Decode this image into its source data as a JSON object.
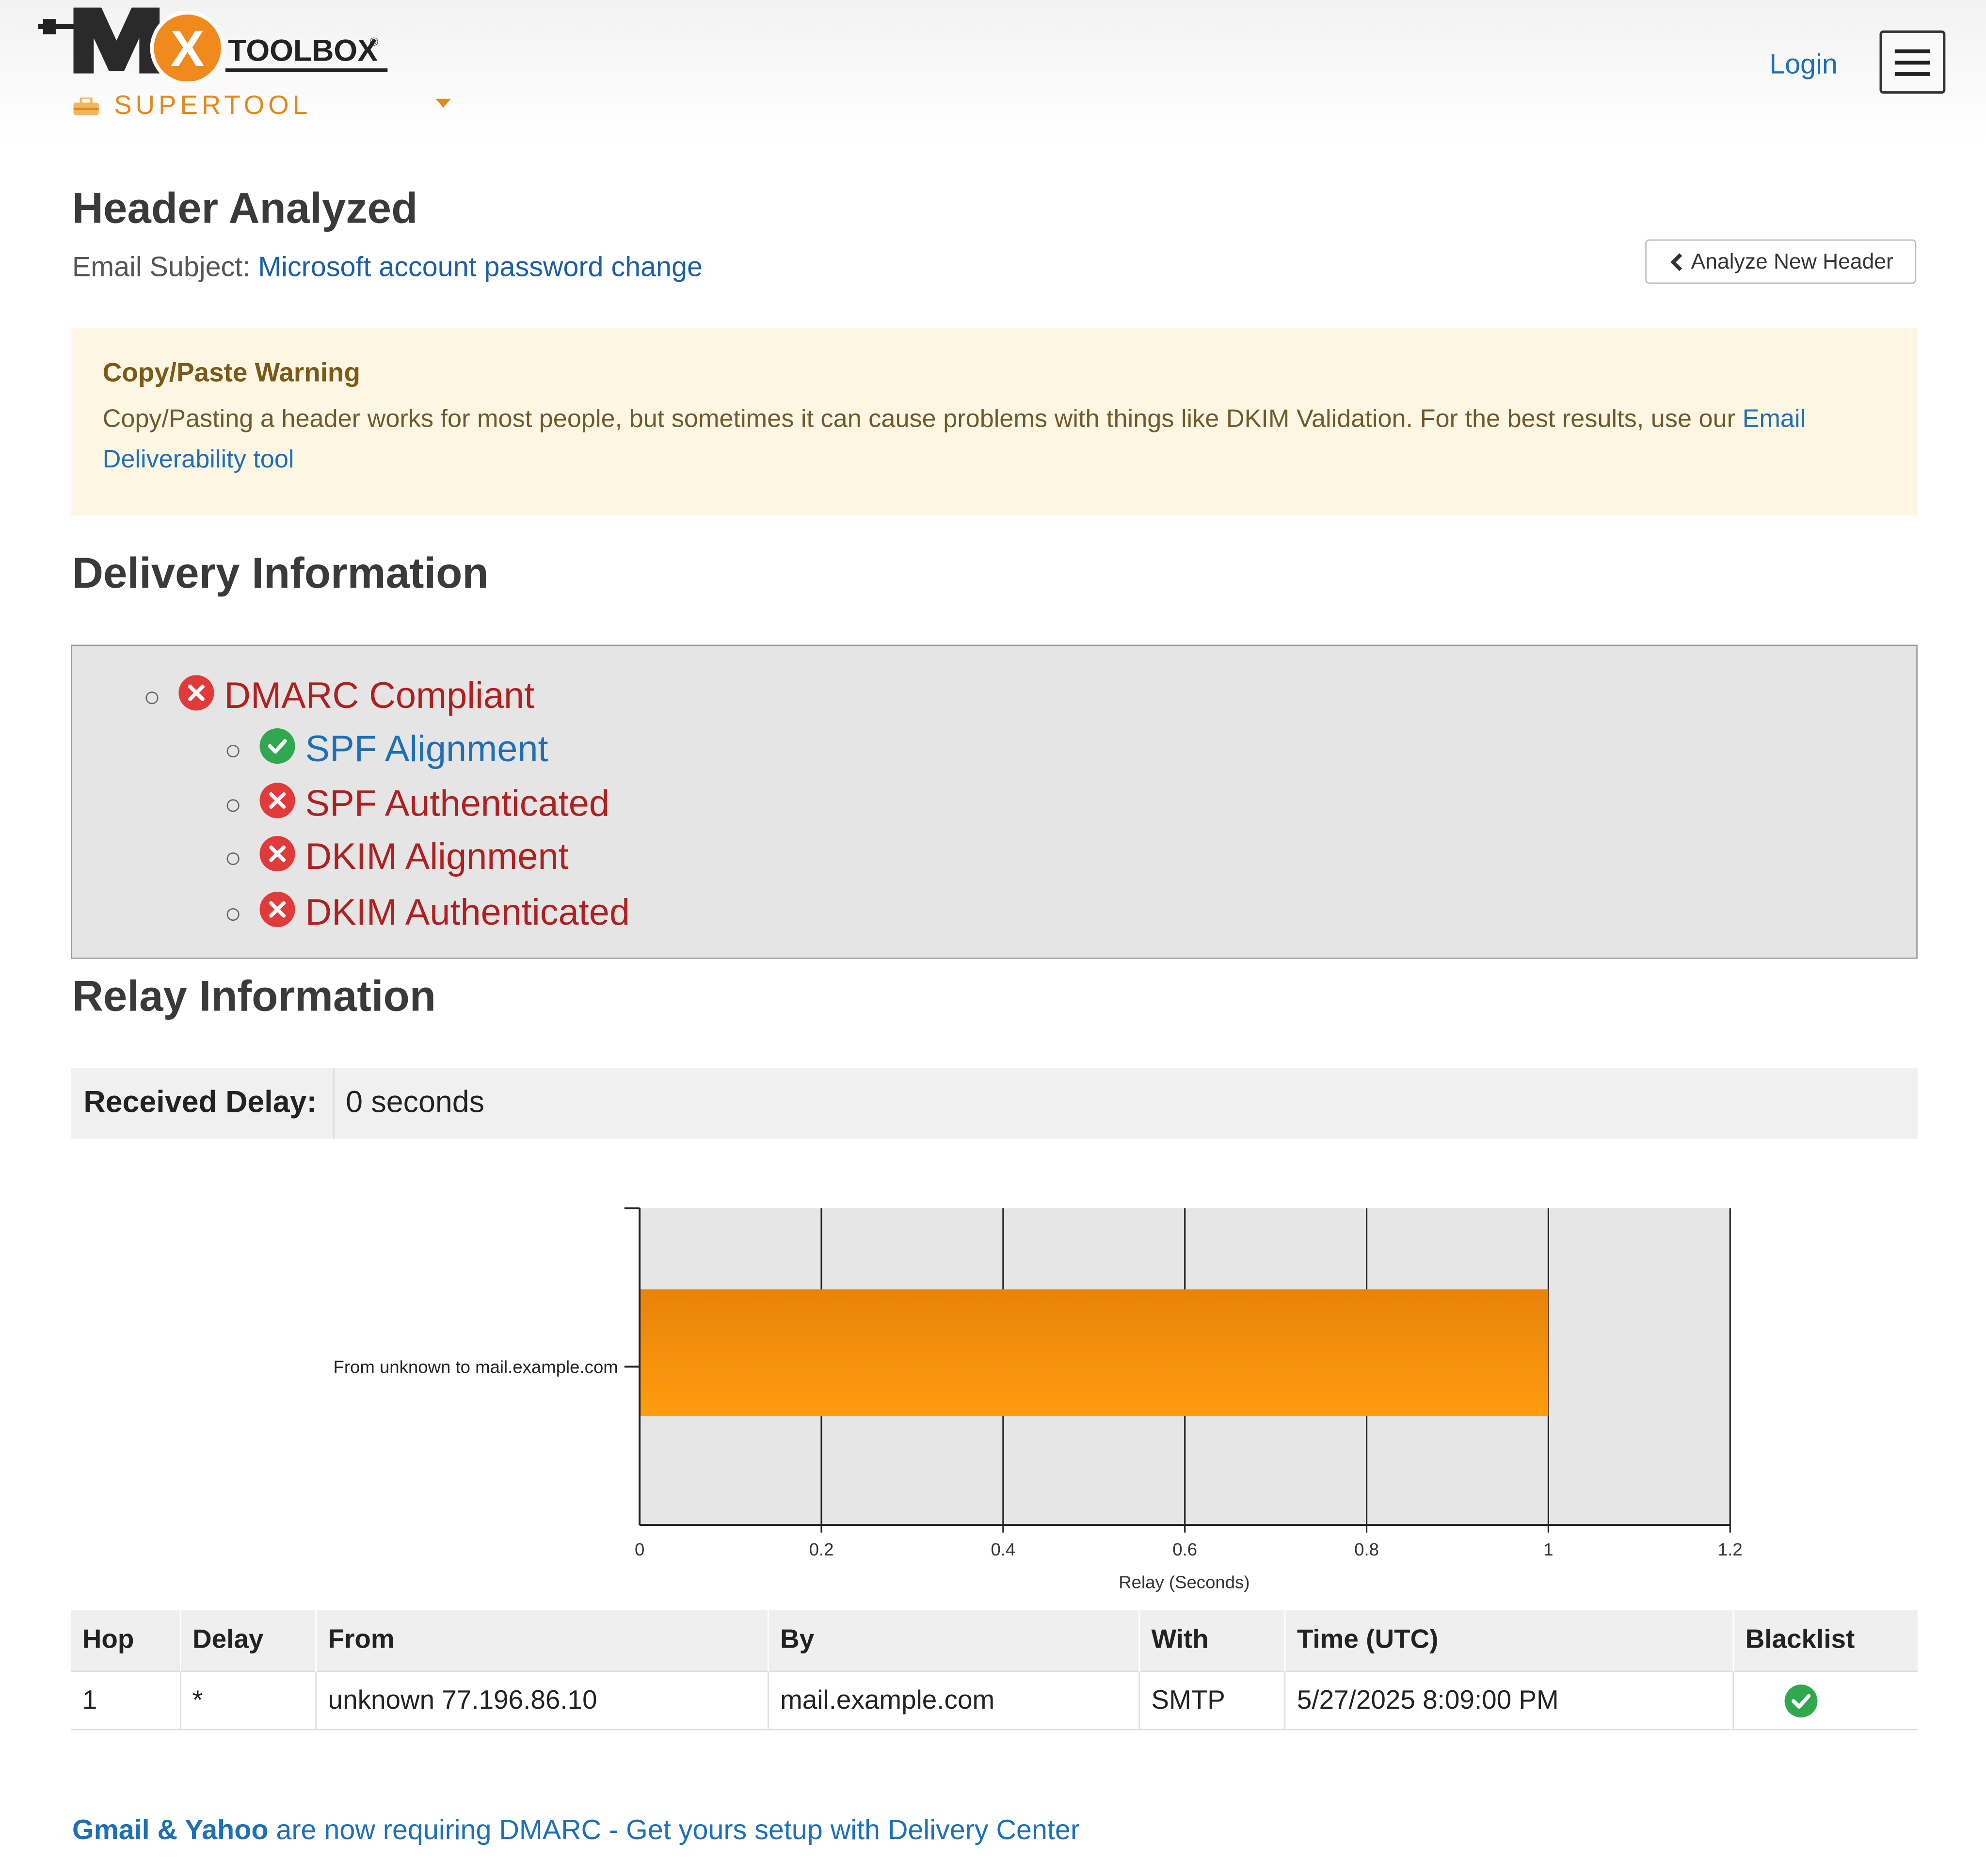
{
  "header": {
    "logo_text": "TOOLBOX",
    "logo_letters": "MX",
    "supertool_label": "SUPERTOOL",
    "login_label": "Login",
    "menu_icon": "hamburger-icon"
  },
  "title": {
    "heading": "Header Analyzed",
    "subject_label": "Email Subject:",
    "subject_value": "Microsoft account password change",
    "analyze_button": "Analyze New Header"
  },
  "warning": {
    "title": "Copy/Paste Warning",
    "body": "Copy/Pasting a header works for most people, but sometimes it can cause problems with things like DKIM Validation. For the best results, use our ",
    "link": "Email Deliverability tool"
  },
  "delivery": {
    "heading": "Delivery Information",
    "items": [
      {
        "label": "DMARC Compliant",
        "status": "fail",
        "icon": "x-circle-icon"
      },
      {
        "label": "SPF Alignment",
        "status": "pass",
        "icon": "check-circle-icon"
      },
      {
        "label": "SPF Authenticated",
        "status": "fail",
        "icon": "x-circle-icon"
      },
      {
        "label": "DKIM Alignment",
        "status": "fail",
        "icon": "x-circle-icon"
      },
      {
        "label": "DKIM Authenticated",
        "status": "fail",
        "icon": "x-circle-icon"
      }
    ],
    "colors": {
      "fail": "#b02020",
      "pass": "#1d6fb8",
      "fail_icon": "#e03a3a",
      "pass_icon": "#2fa84f"
    }
  },
  "relay": {
    "heading": "Relay Information",
    "received_delay_label": "Received Delay:",
    "received_delay_value": "0 seconds"
  },
  "chart_data": {
    "type": "bar",
    "orientation": "horizontal",
    "categories": [
      "From unknown to mail.example.com"
    ],
    "values": [
      1
    ],
    "xlabel": "Relay (Seconds)",
    "ylabel": "",
    "xlim": [
      0,
      1.2
    ],
    "xticks": [
      "0",
      "0.2",
      "0.4",
      "0.6",
      "0.8",
      "1",
      "1.2"
    ],
    "grid": true,
    "bar_color": "#f7940e"
  },
  "hops_table": {
    "columns": [
      "Hop",
      "Delay",
      "From",
      "By",
      "With",
      "Time (UTC)",
      "Blacklist"
    ],
    "rows": [
      {
        "hop": "1",
        "delay": "*",
        "from": "unknown 77.196.86.10",
        "by": "mail.example.com",
        "with": "SMTP",
        "time": "5/27/2025 8:09:00 PM",
        "blacklist": "check-circle-icon"
      }
    ]
  },
  "footer": {
    "bold": "Gmail & Yahoo",
    "text": " are now requiring DMARC - Get yours setup with Delivery Center"
  }
}
